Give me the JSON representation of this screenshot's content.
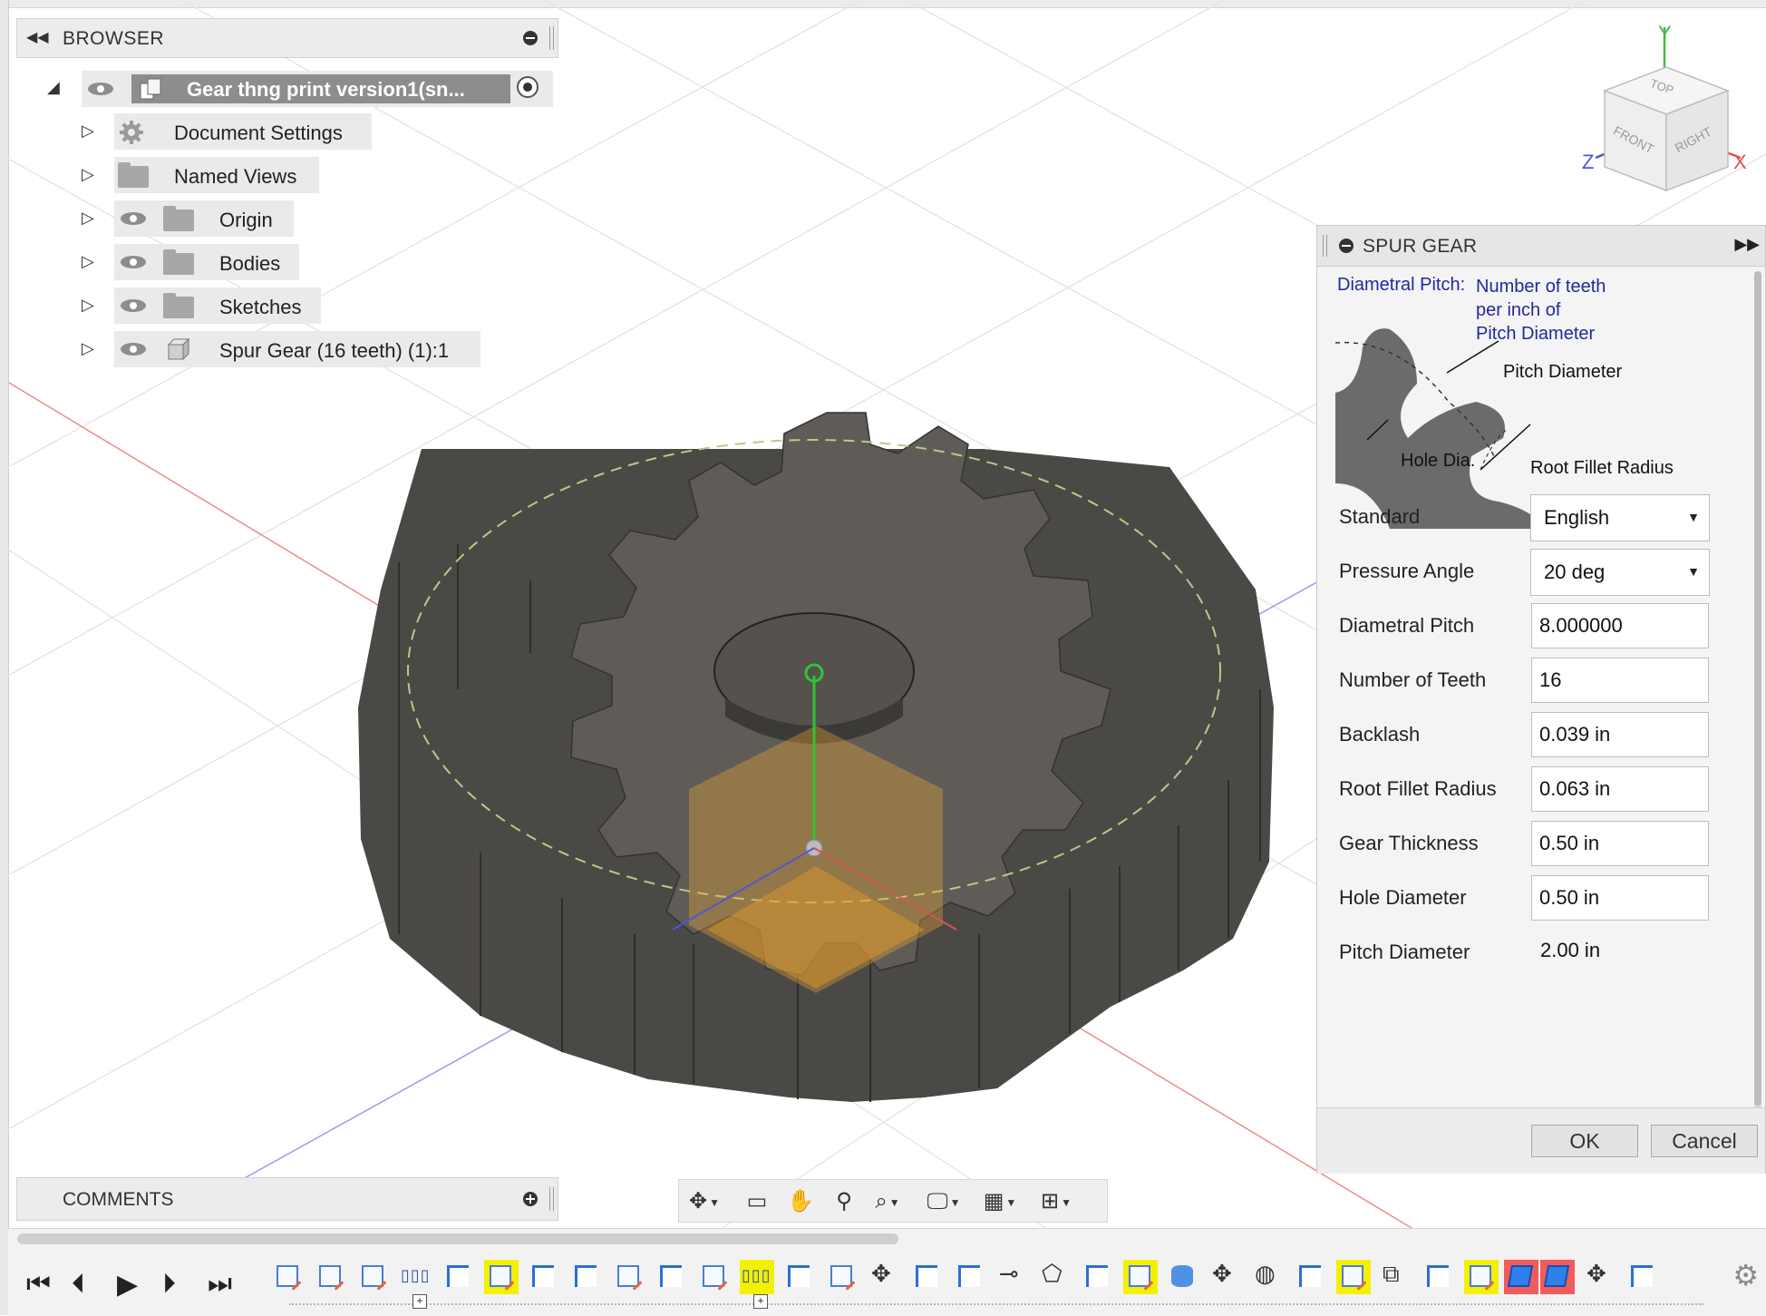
{
  "browser": {
    "title": "BROWSER",
    "root": {
      "label": "Gear thng print version1(sn..."
    },
    "items": [
      {
        "label": "Document Settings",
        "icon": "gear-icon",
        "visible_toggle": false
      },
      {
        "label": "Named Views",
        "icon": "folder-icon",
        "visible_toggle": false
      },
      {
        "label": "Origin",
        "icon": "folder-icon",
        "visible_toggle": true
      },
      {
        "label": "Bodies",
        "icon": "folder-icon",
        "visible_toggle": true
      },
      {
        "label": "Sketches",
        "icon": "folder-icon",
        "visible_toggle": true
      },
      {
        "label": "Spur Gear (16 teeth) (1):1",
        "icon": "component-icon",
        "visible_toggle": true
      }
    ]
  },
  "comments": {
    "title": "COMMENTS"
  },
  "viewcube": {
    "top": "TOP",
    "front": "FRONT",
    "right": "RIGHT",
    "axis_y": "Y",
    "axis_x": "X",
    "axis_z": "Z"
  },
  "dialog": {
    "title": "SPUR GEAR",
    "diagram": {
      "heading_term": "Diametral Pitch:",
      "heading_def_1": "Number of teeth",
      "heading_def_2": "per inch of",
      "heading_def_3": "Pitch Diameter",
      "label_pitch_diameter": "Pitch Diameter",
      "label_hole_dia": "Hole Dia.",
      "label_root_fillet": "Root Fillet Radius"
    },
    "fields": {
      "standard": {
        "label": "Standard",
        "value": "English"
      },
      "pressure_angle": {
        "label": "Pressure Angle",
        "value": "20 deg"
      },
      "diametral_pitch": {
        "label": "Diametral Pitch",
        "value": "8.000000"
      },
      "number_of_teeth": {
        "label": "Number of Teeth",
        "value": "16"
      },
      "backlash": {
        "label": "Backlash",
        "value": "0.039 in"
      },
      "root_fillet_radius": {
        "label": "Root Fillet Radius",
        "value": "0.063 in"
      },
      "gear_thickness": {
        "label": "Gear Thickness",
        "value": "0.50 in"
      },
      "hole_diameter": {
        "label": "Hole Diameter",
        "value": "0.50 in"
      },
      "pitch_diameter": {
        "label": "Pitch Diameter",
        "value": "2.00 in"
      }
    },
    "ok_label": "OK",
    "cancel_label": "Cancel"
  },
  "colors": {
    "gear_top": "#5f5c57",
    "gear_side": "#4a4844",
    "accent_blue": "#1f2a9c",
    "timeline_highlight": "#f3f100",
    "timeline_error": "#f25b5b"
  }
}
